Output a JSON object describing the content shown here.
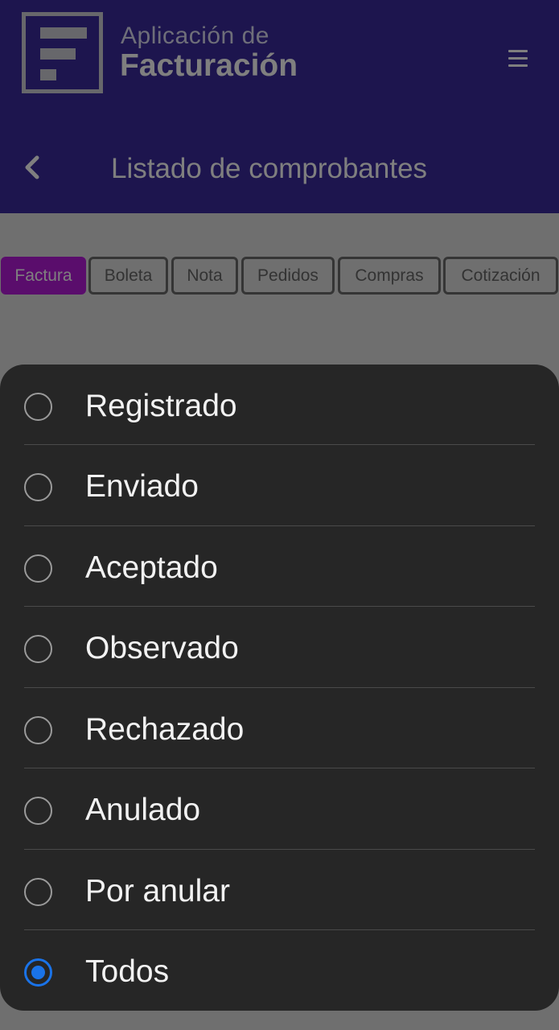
{
  "header": {
    "app_title_line1": "Aplicación de",
    "app_title_line2": "Facturación",
    "page_title": "Listado de comprobantes"
  },
  "tabs": [
    {
      "label": "Factura",
      "active": true
    },
    {
      "label": "Boleta",
      "active": false
    },
    {
      "label": "Nota",
      "active": false
    },
    {
      "label": "Pedidos",
      "active": false
    },
    {
      "label": "Compras",
      "active": false
    },
    {
      "label": "Cotización",
      "active": false
    }
  ],
  "status_filter": {
    "options": [
      {
        "label": "Registrado",
        "selected": false
      },
      {
        "label": "Enviado",
        "selected": false
      },
      {
        "label": "Aceptado",
        "selected": false
      },
      {
        "label": "Observado",
        "selected": false
      },
      {
        "label": "Rechazado",
        "selected": false
      },
      {
        "label": "Anulado",
        "selected": false
      },
      {
        "label": "Por anular",
        "selected": false
      },
      {
        "label": "Todos",
        "selected": true
      }
    ]
  },
  "colors": {
    "header_bg": "#3a2a9c",
    "active_tab": "#b51ad9",
    "radio_selected": "#1a73e8",
    "sheet_bg": "#262626"
  },
  "icons": {
    "logo": "invoice-logo-icon",
    "menu": "hamburger-menu-icon",
    "back": "chevron-left-icon"
  }
}
